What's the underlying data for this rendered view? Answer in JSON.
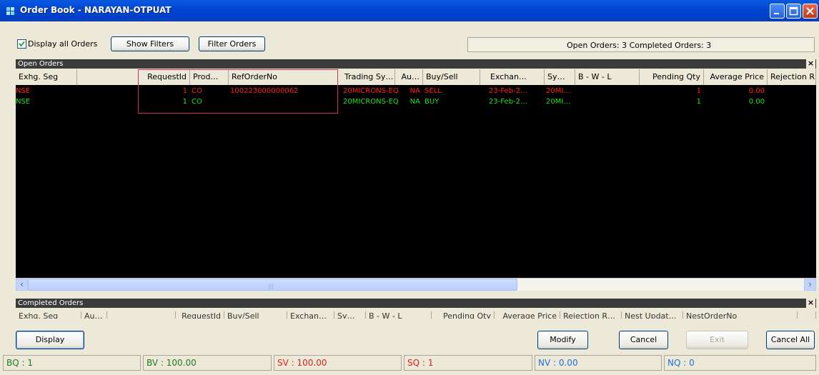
{
  "window": {
    "title": "Order Book - NARAYAN-OTPUAT"
  },
  "toolbar": {
    "display_all_label": "Display all Orders",
    "display_all_checked": true,
    "show_filters_label": "Show Filters",
    "filter_orders_label": "Filter Orders",
    "summary": "Open Orders: 3  Completed Orders: 3"
  },
  "open_orders": {
    "title": "Open Orders",
    "columns": [
      "Exhg. Seg",
      "",
      "RequestId",
      "Prod…",
      "RefOrderNo",
      "Trading Sy…",
      "Au…",
      "Buy/Sell",
      "Exchan…",
      "Sy…",
      "B - W - L",
      "Pending Qty",
      "Average Price",
      "Rejection R"
    ],
    "rows": [
      {
        "color": "#ff2020",
        "cells": [
          "NSE",
          "",
          "1",
          "CO",
          "100223000000062",
          "20MICRONS-EQ",
          "NA",
          "SELL",
          "23-Feb-2…",
          "20MI…",
          "",
          "1",
          "0.00",
          ""
        ]
      },
      {
        "color": "#22e022",
        "cells": [
          "NSE",
          "",
          "1",
          "CO",
          "",
          "20MICRONS-EQ",
          "NA",
          "BUY",
          "23-Feb-2…",
          "20MI…",
          "",
          "1",
          "0.00",
          ""
        ]
      }
    ]
  },
  "completed_orders": {
    "title": "Completed Orders",
    "columns": [
      "Exhg. Seg",
      "Au…",
      "",
      "RequestId",
      "Buy/Sell",
      "Exchan…",
      "Sy…",
      "B - W - L",
      "Pending Qty",
      "Average Price",
      "Rejection R…",
      "Nest Updat…",
      "NestOrderNo",
      ""
    ]
  },
  "buttons": {
    "display": "Display",
    "modify": "Modify",
    "cancel": "Cancel",
    "exit": "Exit",
    "cancel_all": "Cancel All"
  },
  "status": {
    "bq": "BQ : 1",
    "bv": "BV : 100.00",
    "sv": "SV : 100.00",
    "sq": "SQ : 1",
    "nv": "NV : 0.00",
    "nq": "NQ : 0"
  },
  "colors": {
    "title_bar": "#0046d5",
    "grid_bg": "#000000",
    "sell": "#ff2020",
    "buy": "#22e022",
    "highlight": "#d0306a"
  }
}
